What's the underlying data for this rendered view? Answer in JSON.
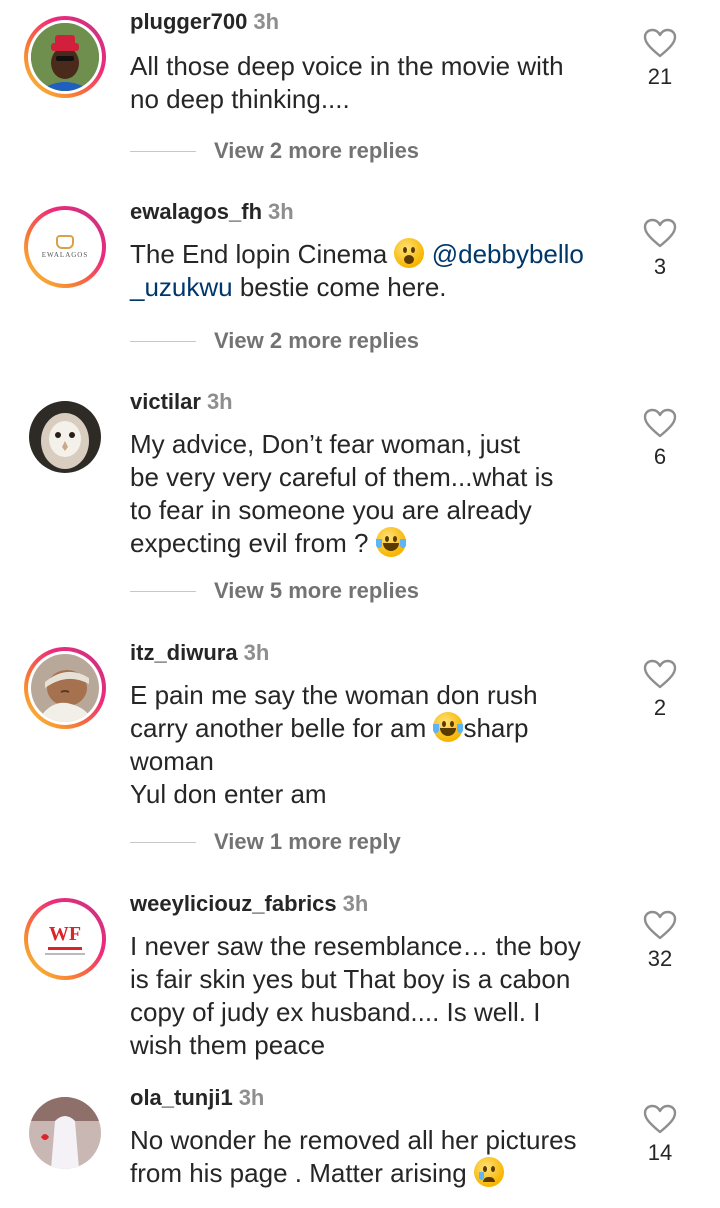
{
  "comments": [
    {
      "username": "plugger700",
      "time": "3h",
      "text_parts": [
        "All those deep voice in the movie with\nno deep thinking...."
      ],
      "likes": "21",
      "replies": "View 2 more replies",
      "avatar": "person-red-hat"
    },
    {
      "username": "ewalagos_fh",
      "time": "3h",
      "text_a": "The End lopin Cinema ",
      "mention": "@debbybello\n_uzukwu",
      "text_b": " bestie come here.",
      "likes": "3",
      "replies": "View 2 more replies",
      "avatar_logo_text": "EWALAGOS"
    },
    {
      "username": "victilar",
      "time": "3h",
      "text_a": "My advice, Don’t fear woman, just\nbe very very careful of them...what is\nto fear in someone you are already\nexpecting evil from ? ",
      "likes": "6",
      "replies": "View 5 more replies",
      "avatar": "owl"
    },
    {
      "username": "itz_diwura",
      "time": "3h",
      "text_a": "E pain me say the woman don rush\ncarry another belle for am ",
      "text_b": "sharp\nwoman\nYul don enter am",
      "likes": "2",
      "replies": "View 1 more reply",
      "avatar": "baby"
    },
    {
      "username": "weeyliciouz_fabrics",
      "time": "3h",
      "text_a": "I never saw the resemblance… the boy\nis fair skin yes but That boy is a cabon\ncopy of judy ex husband.... Is well. I\nwish them peace",
      "likes": "32",
      "avatar_logo_text": "WF"
    },
    {
      "username": "ola_tunji1",
      "time": "3h",
      "text_a": "No wonder he removed all her pictures\nfrom his page . Matter arising ",
      "likes": "14",
      "avatar": "white-outfit"
    }
  ],
  "colors": {
    "ring_start": "#f9ce34",
    "ring_end": "#c13584",
    "mention": "#00376b",
    "muted": "#8e8e8e"
  }
}
